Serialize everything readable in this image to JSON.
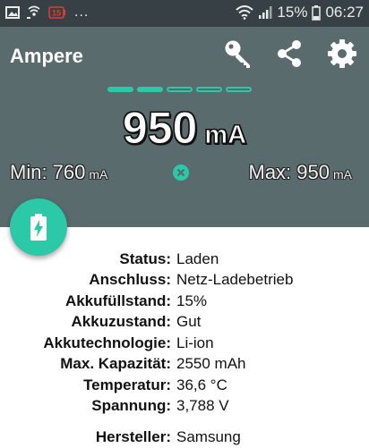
{
  "status_bar": {
    "dots": "...",
    "battery_percent": "15%",
    "time": "06:27",
    "icons": [
      "image-icon",
      "wifi-calling-icon",
      "battery-warning-icon",
      "wifi-icon",
      "signal-icon",
      "battery-icon"
    ]
  },
  "header": {
    "title": "Ampere",
    "actions": [
      "key-icon",
      "share-icon",
      "settings-gear-icon"
    ],
    "pager": {
      "total": 5,
      "active": 2
    }
  },
  "reading": {
    "value": "950",
    "unit": "mA",
    "min_label": "Min: 760",
    "min_unit": "mA",
    "max_label": "Max: 950",
    "max_unit": "mA"
  },
  "info": [
    {
      "key": "Status:",
      "value": "Laden"
    },
    {
      "key": "Anschluss:",
      "value": "Netz-Ladebetrieb"
    },
    {
      "key": "Akkufüllstand:",
      "value": "15%"
    },
    {
      "key": "Akkuzustand:",
      "value": "Gut"
    },
    {
      "key": "Akkutechnologie:",
      "value": "Li-ion"
    },
    {
      "key": "Max. Kapazität:",
      "value": "2550 mAh"
    },
    {
      "key": "Temperatur:",
      "value": "36,6 °C"
    },
    {
      "key": "Spannung:",
      "value": "3,788 V"
    },
    {
      "key": "Hersteller:",
      "value": "Samsung"
    }
  ],
  "colors": {
    "accent": "#2bc9a8",
    "header_bg": "#5a6b6d",
    "status_bar_bg": "#374044"
  }
}
